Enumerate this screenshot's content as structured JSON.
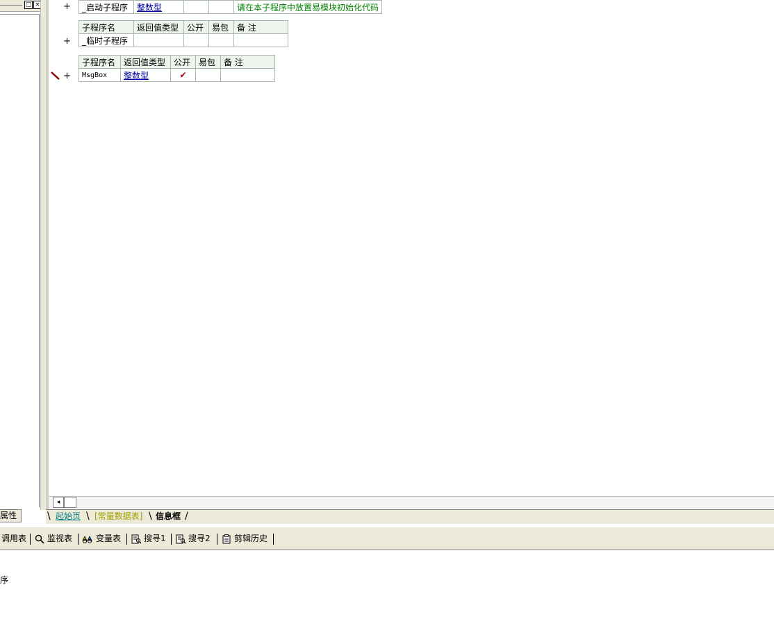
{
  "left_panel": {
    "restore_glyph": "□",
    "close_glyph": "×",
    "properties_tab": "属性"
  },
  "code": {
    "table1": {
      "row": {
        "name": "_启动子程序",
        "return_type": "整数型",
        "public": "",
        "pkg": "",
        "note": "请在本子程序中放置易模块初始化代码"
      }
    },
    "table2": {
      "headers": [
        "子程序名",
        "返回值类型",
        "公开",
        "易包",
        "备 注"
      ],
      "row": {
        "name": "_临时子程序",
        "return_type": "",
        "public": "",
        "pkg": "",
        "note": ""
      }
    },
    "table3": {
      "headers": [
        "子程序名",
        "返回值类型",
        "公开",
        "易包",
        "备 注"
      ],
      "row": {
        "name": "MsgBox",
        "return_type": "整数型",
        "public": "✔",
        "pkg": "",
        "note": ""
      }
    },
    "plus_glyph": "+"
  },
  "scrollbar": {
    "left_arrow": "◂"
  },
  "tabs": {
    "start_page": "起始页",
    "constants": "[常量数据表]",
    "info_box": "信息框"
  },
  "bottom_toolbar": {
    "call_table": "调用表",
    "watch": "监视表",
    "variables": "变量表",
    "search1": "搜寻1",
    "search2": "搜寻2",
    "clip_history": "剪辑历史"
  },
  "output": {
    "text": "序"
  }
}
